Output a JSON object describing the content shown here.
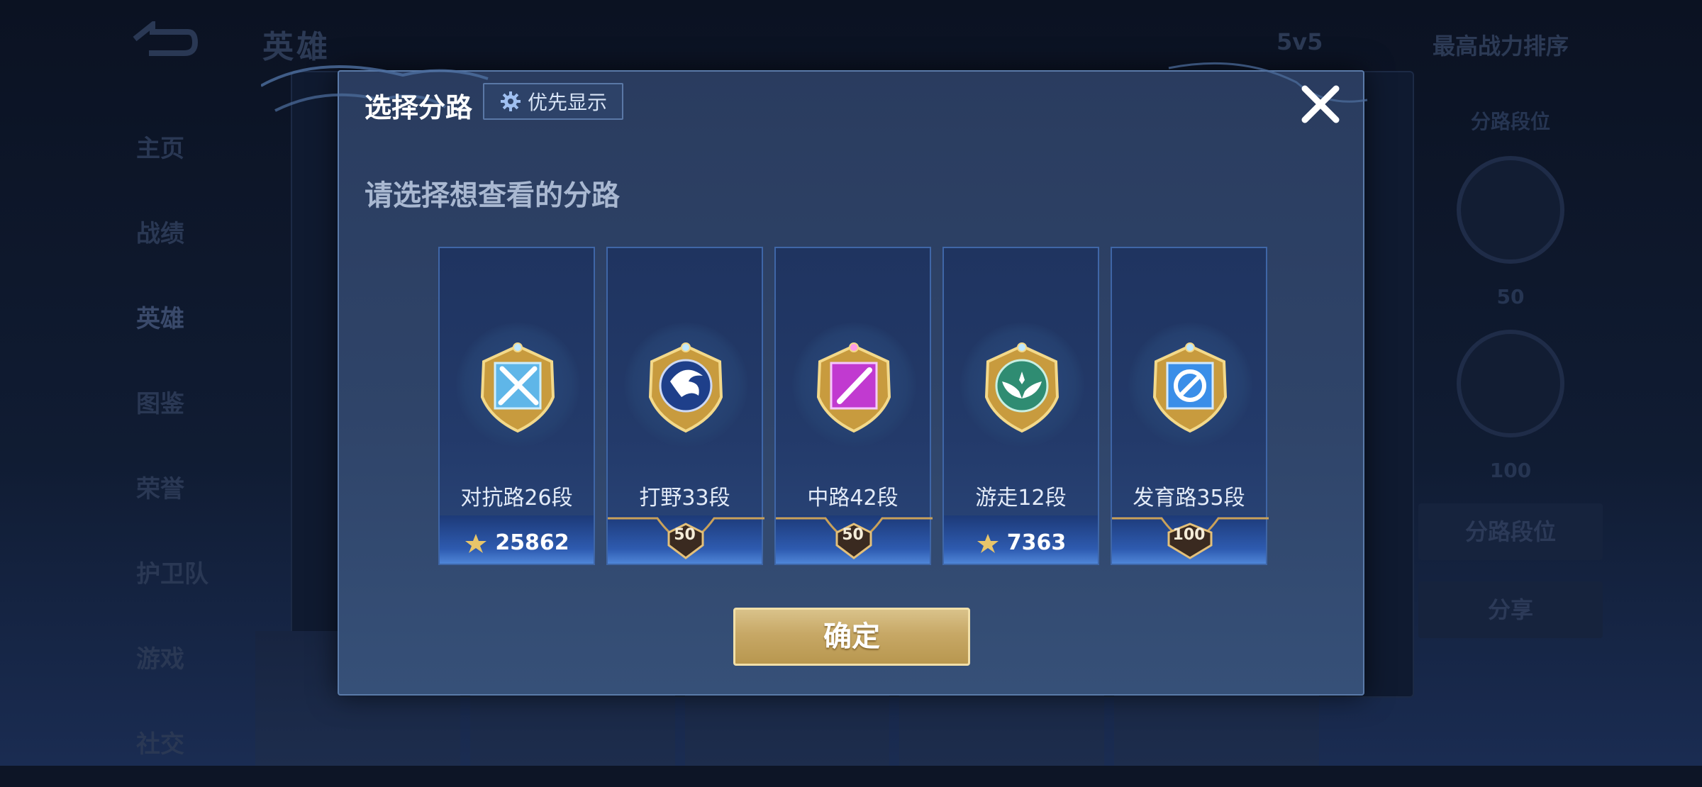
{
  "background": {
    "title": "英雄",
    "mode": "5v5",
    "sort": "最高战力排序",
    "nav": [
      "主页",
      "战绩",
      "英雄",
      "图鉴",
      "荣誉",
      "护卫队",
      "游戏",
      "社交"
    ],
    "right_panel": {
      "label": "分路段位",
      "badge_a": "50",
      "badge_b": "100",
      "button_rank": "分路段位",
      "button_share": "分享"
    }
  },
  "dialog": {
    "title": "选择分路",
    "pref_button": "优先显示",
    "subtitle": "请选择想查看的分路",
    "confirm": "确定"
  },
  "lanes": [
    {
      "name": "对抗路26段",
      "score": "25862",
      "rank_badge": null,
      "color": "#5fb6e8",
      "icon": "swords-icon"
    },
    {
      "name": "打野33段",
      "score": null,
      "rank_badge": "50",
      "color": "#1e3f8a",
      "icon": "dragon-icon"
    },
    {
      "name": "中路42段",
      "score": null,
      "rank_badge": "50",
      "color": "#c13ad0",
      "icon": "staff-icon"
    },
    {
      "name": "游走12段",
      "score": "7363",
      "rank_badge": null,
      "color": "#2f8c72",
      "icon": "wings-icon"
    },
    {
      "name": "发育路35段",
      "score": null,
      "rank_badge": "100",
      "color": "#3a8ee8",
      "icon": "target-icon"
    }
  ]
}
